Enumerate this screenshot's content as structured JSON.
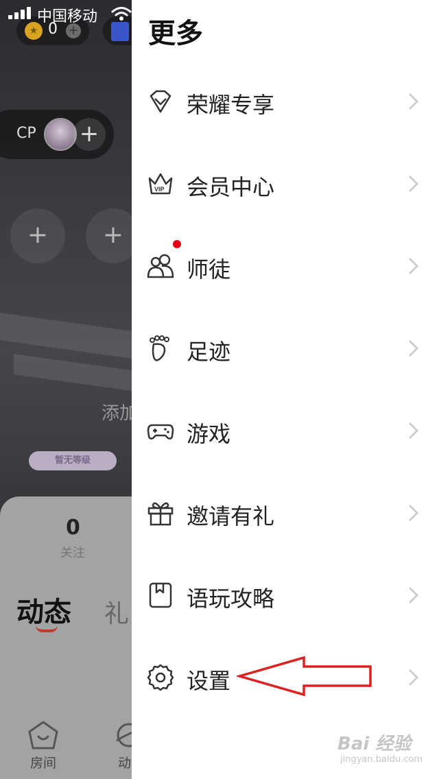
{
  "status_bar": {
    "carrier": "中国移动"
  },
  "profile_bg": {
    "coin_count": "0",
    "coin_add": "+",
    "cp_label": "CP",
    "cp_add": "+",
    "slot_add": "+",
    "add_hint": "添加",
    "level_badge": "暂无等级",
    "follow_count": "0",
    "follow_label": "关注",
    "tab_dynamic": "动态",
    "tab_gift": "礼",
    "nav_room": "房间",
    "nav_dynamic": "动"
  },
  "drawer": {
    "title": "更多",
    "items": [
      {
        "label": "荣耀专享",
        "icon": "diamond-icon"
      },
      {
        "label": "会员中心",
        "icon": "vip-crown-icon"
      },
      {
        "label": "师徒",
        "icon": "mentor-icon",
        "badge": "red-dot"
      },
      {
        "label": "足迹",
        "icon": "footprint-icon"
      },
      {
        "label": "游戏",
        "icon": "gamepad-icon"
      },
      {
        "label": "邀请有礼",
        "icon": "gift-icon"
      },
      {
        "label": "语玩攻略",
        "icon": "guide-icon"
      },
      {
        "label": "设置",
        "icon": "gear-icon"
      }
    ]
  },
  "watermark": {
    "main": "Bai 经验",
    "sub": "jingyan.baidu.com"
  },
  "colors": {
    "accent_red": "#e60012",
    "battery": "#4cd964",
    "annotation_arrow": "#e02020"
  }
}
